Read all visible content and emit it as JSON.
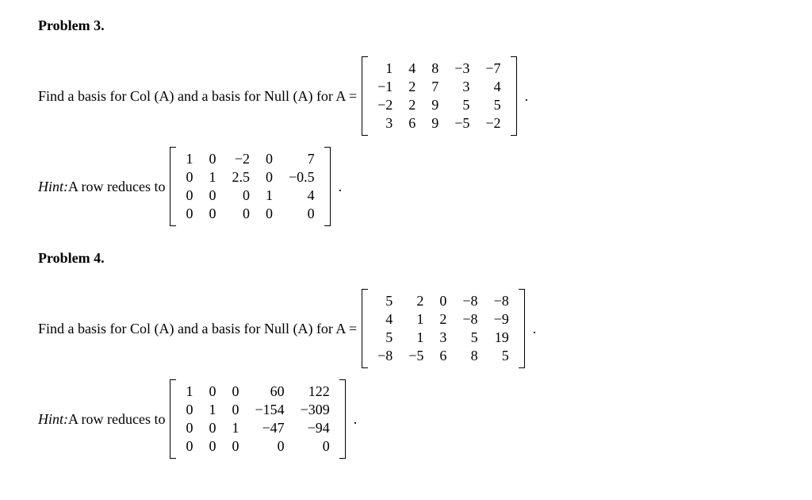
{
  "problems": [
    {
      "title": "Problem 3.",
      "prompt_prefix": "Find a basis for Col (A) and a basis for Null (A) for A =",
      "matrix_A": [
        [
          "1",
          "4",
          "8",
          "−3",
          "−7"
        ],
        [
          "−1",
          "2",
          "7",
          "3",
          "4"
        ],
        [
          "−2",
          "2",
          "9",
          "5",
          "5"
        ],
        [
          "3",
          "6",
          "9",
          "−5",
          "−2"
        ]
      ],
      "hint_prefix": "Hint:",
      "hint_text": " A row reduces to",
      "matrix_R": [
        [
          "1",
          "0",
          "−2",
          "0",
          "7"
        ],
        [
          "0",
          "1",
          "2.5",
          "0",
          "−0.5"
        ],
        [
          "0",
          "0",
          "0",
          "1",
          "4"
        ],
        [
          "0",
          "0",
          "0",
          "0",
          "0"
        ]
      ]
    },
    {
      "title": "Problem 4.",
      "prompt_prefix": "Find a basis for Col (A) and a basis for Null (A) for A =",
      "matrix_A": [
        [
          "5",
          "2",
          "0",
          "−8",
          "−8"
        ],
        [
          "4",
          "1",
          "2",
          "−8",
          "−9"
        ],
        [
          "5",
          "1",
          "3",
          "5",
          "19"
        ],
        [
          "−8",
          "−5",
          "6",
          "8",
          "5"
        ]
      ],
      "hint_prefix": "Hint:",
      "hint_text": " A row reduces to",
      "matrix_R": [
        [
          "1",
          "0",
          "0",
          "60",
          "122"
        ],
        [
          "0",
          "1",
          "0",
          "−154",
          "−309"
        ],
        [
          "0",
          "0",
          "1",
          "−47",
          "−94"
        ],
        [
          "0",
          "0",
          "0",
          "0",
          "0"
        ]
      ]
    }
  ],
  "period": "."
}
